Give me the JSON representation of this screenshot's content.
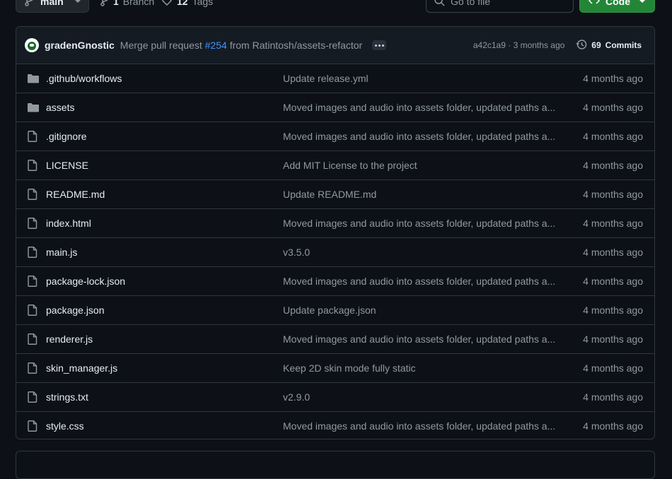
{
  "toolbar": {
    "branch_name": "main",
    "branch_count": "1",
    "branch_label": "Branch",
    "tag_count": "12",
    "tag_label": "Tags",
    "goto_placeholder": "Go to file",
    "code_label": "Code"
  },
  "latest_commit": {
    "author": "gradenGnostic",
    "message_prefix": "Merge pull request",
    "pr_number": "#254",
    "message_suffix": "from Ratintosh/assets-refactor",
    "sha": "a42c1a9",
    "separator": "·",
    "time": "3 months ago",
    "commit_count": "69",
    "commit_label": "Commits"
  },
  "files": [
    {
      "type": "folder",
      "name": ".github/workflows",
      "message": "Update release.yml",
      "time": "4 months ago"
    },
    {
      "type": "folder",
      "name": "assets",
      "message": "Moved images and audio into assets folder, updated paths a...",
      "time": "4 months ago"
    },
    {
      "type": "file",
      "name": ".gitignore",
      "message": "Moved images and audio into assets folder, updated paths a...",
      "time": "4 months ago"
    },
    {
      "type": "file",
      "name": "LICENSE",
      "message": "Add MIT License to the project",
      "time": "4 months ago"
    },
    {
      "type": "file",
      "name": "README.md",
      "message": "Update README.md",
      "time": "4 months ago"
    },
    {
      "type": "file",
      "name": "index.html",
      "message": "Moved images and audio into assets folder, updated paths a...",
      "time": "4 months ago"
    },
    {
      "type": "file",
      "name": "main.js",
      "message": "v3.5.0",
      "time": "4 months ago"
    },
    {
      "type": "file",
      "name": "package-lock.json",
      "message": "Moved images and audio into assets folder, updated paths a...",
      "time": "4 months ago"
    },
    {
      "type": "file",
      "name": "package.json",
      "message": "Update package.json",
      "time": "4 months ago"
    },
    {
      "type": "file",
      "name": "renderer.js",
      "message": "Moved images and audio into assets folder, updated paths a...",
      "time": "4 months ago"
    },
    {
      "type": "file",
      "name": "skin_manager.js",
      "message": "Keep 2D skin mode fully static",
      "time": "4 months ago"
    },
    {
      "type": "file",
      "name": "strings.txt",
      "message": "v2.9.0",
      "time": "4 months ago"
    },
    {
      "type": "file",
      "name": "style.css",
      "message": "Moved images and audio into assets folder, updated paths a...",
      "time": "4 months ago"
    }
  ],
  "colors": {
    "background": "#0d1117",
    "link": "#4493f8",
    "code_button": "#238636",
    "muted_text": "#9198a1"
  }
}
